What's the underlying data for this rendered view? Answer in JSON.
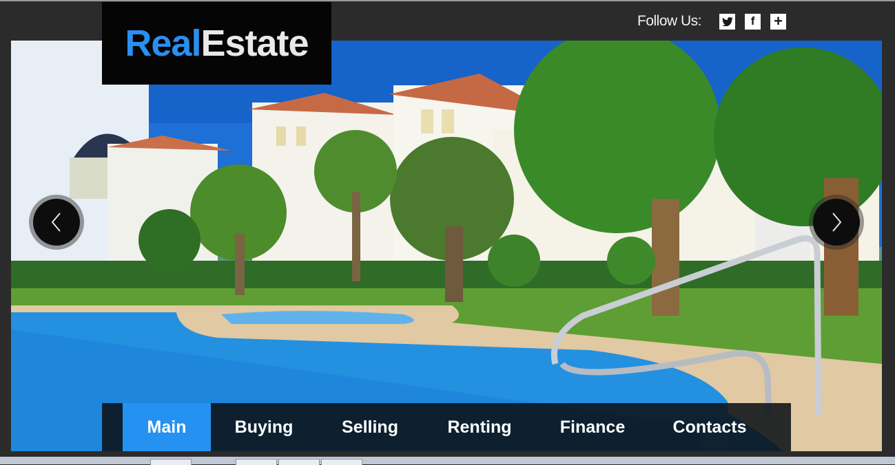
{
  "brand": {
    "part1": "Real",
    "part2": "Estate",
    "accent_color": "#2a8ff0"
  },
  "follow": {
    "label": "Follow Us:",
    "icons": [
      "twitter-icon",
      "facebook-icon",
      "plus-icon"
    ],
    "facebook_glyph": "f",
    "plus_glyph": "+"
  },
  "slider": {
    "image": "resort-pool-palm-trees",
    "prev_icon": "chevron-left-icon",
    "next_icon": "chevron-right-icon"
  },
  "nav": {
    "active_color": "#2591f0",
    "items": [
      {
        "label": "Main",
        "active": true
      },
      {
        "label": "Buying",
        "active": false
      },
      {
        "label": "Selling",
        "active": false
      },
      {
        "label": "Renting",
        "active": false
      },
      {
        "label": "Finance",
        "active": false
      },
      {
        "label": "Contacts",
        "active": false
      }
    ]
  }
}
